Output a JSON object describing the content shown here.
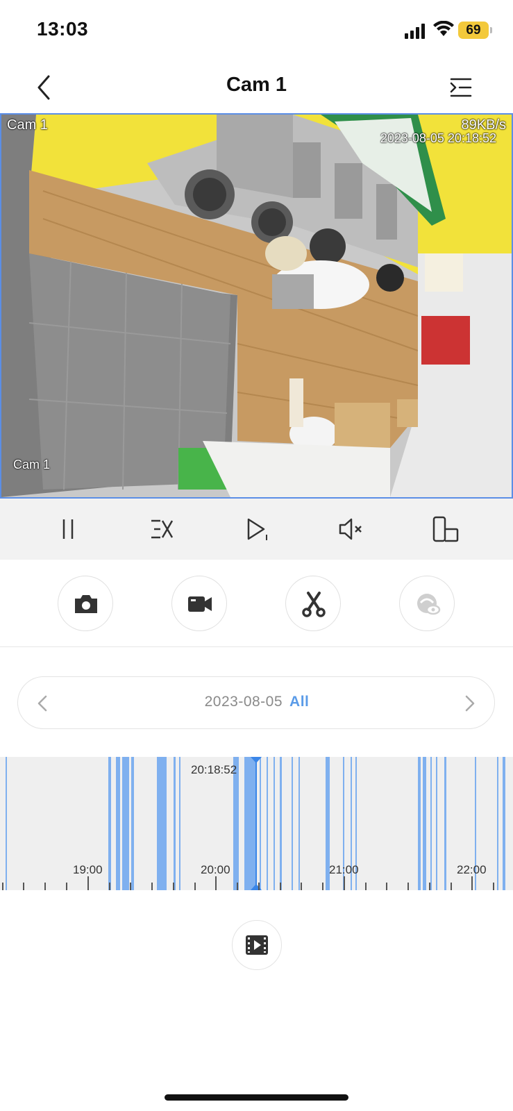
{
  "status_bar": {
    "time": "13:03",
    "battery": "69"
  },
  "nav": {
    "title": "Cam 1"
  },
  "video": {
    "channel_label": "Cam 1",
    "bitrate": "89KB/s",
    "osd_timestamp": "2023-08-05 20:18:52",
    "osd_channel": "Cam 1"
  },
  "controls": [
    "pause-icon",
    "playback-speed-icon",
    "play-frame-icon",
    "mute-icon",
    "fullscreen-rotate-icon"
  ],
  "actions": [
    "snapshot-icon",
    "record-video-icon",
    "clip-icon",
    "view-icon"
  ],
  "date_selector": {
    "date": "2023-08-05",
    "filter": "All"
  },
  "timeline": {
    "cursor_time": "20:18:52",
    "hour_labels": [
      "19:00",
      "20:00",
      "21:00",
      "22:00"
    ],
    "accent_color": "#5a9be8"
  },
  "colors": {
    "accent": "#5a9be8",
    "video_border": "#5b8ee6",
    "battery": "#f3c93b"
  }
}
